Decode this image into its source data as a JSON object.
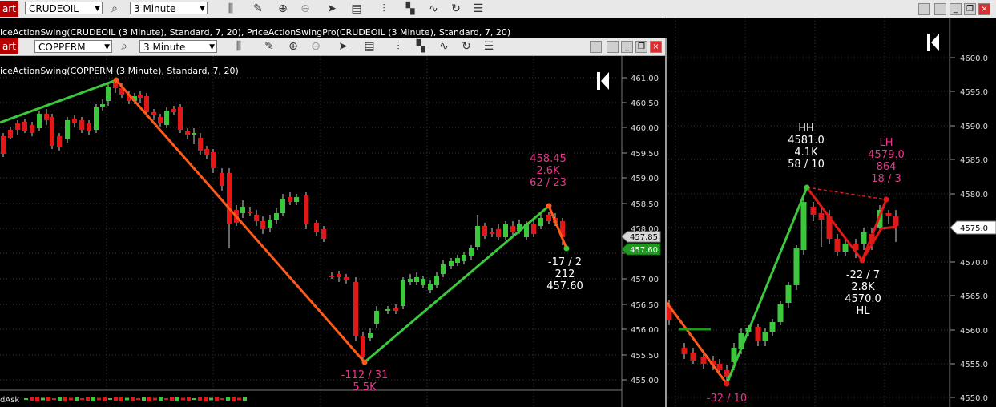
{
  "outer_window": {
    "tab_label": "art",
    "symbol": "CRUDEOIL",
    "interval": "3 Minute",
    "indicator_strip": "iceActionSwing(CRUDEOIL (3 Minute), Standard, 7, 20), PriceActionSwingPro(CRUDEOIL (3 Minute), Standard, 7, 20)",
    "price_axis": [
      "4600.0",
      "4595.0",
      "4590.0",
      "4585.0",
      "4580.0",
      "4575.0",
      "4570.0",
      "4565.0",
      "4560.0",
      "4555.0",
      "4550.0"
    ],
    "current_price": "4575.0",
    "annotations": {
      "hh": {
        "label": "HH",
        "price": "4581.0",
        "volume": "4.1K",
        "bars": "58 / 10"
      },
      "lh": {
        "label": "LH",
        "price": "4579.0",
        "volume": "864",
        "bars": "18 / 3"
      },
      "hl": {
        "bars": "-22 / 7",
        "volume": "2.8K",
        "price": "4570.0",
        "label": "HL"
      },
      "low": {
        "bars": "-32 / 10"
      }
    }
  },
  "inner_window": {
    "tab_label": "art",
    "symbol": "COPPERM",
    "interval": "3 Minute",
    "indicator_strip": "iceActionSwing(COPPERM (3 Minute), Standard, 7, 20)",
    "price_axis": [
      "461.00",
      "460.50",
      "460.00",
      "459.50",
      "459.00",
      "458.50",
      "458.00",
      "457.50",
      "457.00",
      "456.50",
      "456.00",
      "455.50",
      "455.00"
    ],
    "price_tag_grey": "457.85",
    "price_tag_green": "457.60",
    "annotations": {
      "high": {
        "price": "458.45",
        "volume": "2.6K",
        "bars": "62 / 23"
      },
      "last": {
        "bars": "-17 / 2",
        "volume": "212",
        "price": "457.60"
      },
      "low": {
        "bars": "-112 / 31",
        "volume": "5.5K"
      }
    },
    "lower_panel_label": "dAsk"
  },
  "colors": {
    "up": "#3cc83c",
    "down": "#e01818",
    "swing_up": "#3cc83c",
    "swing_down": "#ff5a1a",
    "pink": "#e8388c",
    "grid": "#3a3a3a"
  }
}
